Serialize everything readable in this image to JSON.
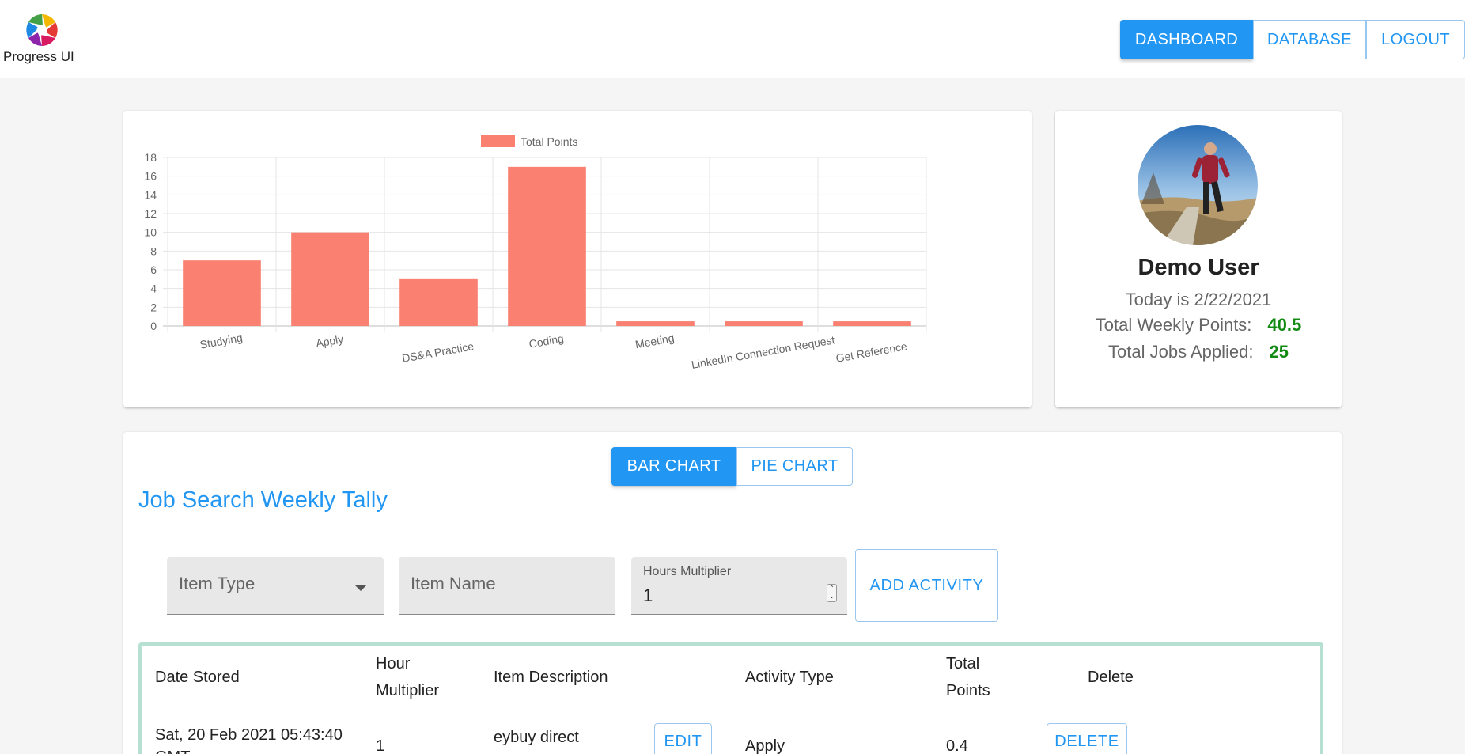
{
  "app": {
    "logo_text": "Progress UI"
  },
  "nav": {
    "items": [
      {
        "label": "DASHBOARD",
        "active": true
      },
      {
        "label": "DATABASE",
        "active": false
      },
      {
        "label": "LOGOUT",
        "active": false
      }
    ]
  },
  "chart_data": {
    "type": "bar",
    "categories": [
      "Studying",
      "Apply",
      "DS&A Practice",
      "Coding",
      "Meeting",
      "LinkedIn Connection Request",
      "Get Reference"
    ],
    "series": [
      {
        "name": "Total Points",
        "values": [
          7,
          10,
          5,
          17,
          0.5,
          0.5,
          0.5
        ],
        "color": "#fa8072"
      }
    ],
    "y_ticks": [
      0,
      2,
      4,
      6,
      8,
      10,
      12,
      14,
      16,
      18
    ],
    "ylim": [
      0,
      18
    ],
    "grid": true,
    "legend_position": "top"
  },
  "profile": {
    "name": "Demo User",
    "today": "Today is 2/22/2021",
    "weekly_points_label": "Total Weekly Points:",
    "weekly_points_value": "40.5",
    "jobs_applied_label": "Total Jobs Applied:",
    "jobs_applied_value": "25",
    "value_color": "#138a13"
  },
  "chart_toggle": {
    "bar_label": "BAR CHART",
    "pie_label": "PIE CHART",
    "selected": "bar"
  },
  "section": {
    "title": "Job Search Weekly Tally"
  },
  "form": {
    "item_type_placeholder": "Item Type",
    "item_name_placeholder": "Item Name",
    "hours_label": "Hours Multiplier",
    "hours_value": "1",
    "add_label": "ADD ACTIVITY"
  },
  "table": {
    "headers": {
      "date": "Date Stored",
      "hour_line1": "Hour",
      "hour_line2": "Multiplier",
      "desc": "Item Description",
      "activity": "Activity Type",
      "total_line1": "Total",
      "total_line2": "Points",
      "delete": "Delete"
    },
    "rows": [
      {
        "date_line1": "Sat, 20 Feb 2021 05:43:40",
        "date_line2": "GMT",
        "hour": "1",
        "description": "eybuy direct",
        "edit_label": "EDIT",
        "activity": "Apply",
        "total": "0.4",
        "delete_label": "DELETE"
      }
    ]
  },
  "colors": {
    "primary": "#2196f3",
    "bar": "#fa8072",
    "table_border": "#b7e0d3"
  }
}
